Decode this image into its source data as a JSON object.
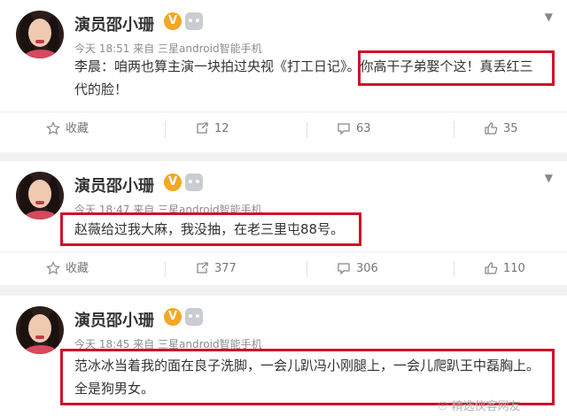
{
  "posts": [
    {
      "username": "演员邵小珊",
      "vip_badge": "V",
      "meta": "今天 18:51 来自 三星android智能手机",
      "text_line1": "李晨：咱两也算主演一块拍过央视《打工日记》。你高干子弟娶个这！真丢红三",
      "text_line2": "代的脸！",
      "actions": {
        "favorite": "收藏",
        "repost": "12",
        "comment": "63",
        "like": "35"
      }
    },
    {
      "username": "演员邵小珊",
      "vip_badge": "V",
      "meta": "今天 18:47 来自 三星android智能手机",
      "text_line1": "赵薇给过我大麻，我没抽，在老三里屯88号。",
      "actions": {
        "favorite": "收藏",
        "repost": "377",
        "comment": "306",
        "like": "110"
      }
    },
    {
      "username": "演员邵小珊",
      "vip_badge": "V",
      "meta": "今天 18:45 来自 三星android智能手机",
      "text_line1": "范冰冰当着我的面在良子洗脚，一会儿趴冯小刚腿上，一会儿爬趴王中磊胸上。",
      "text_line2": "全是狗男女。"
    }
  ],
  "watermark": "精选侠客网友",
  "colors": {
    "highlight_border": "#d0102a",
    "vip_badge": "#f5a623",
    "text": "#333333",
    "meta": "#8c8c8c"
  },
  "icons": [
    "star-icon",
    "repost-icon",
    "comment-icon",
    "thumbs-up-icon",
    "chevron-down-icon",
    "robot-icon"
  ]
}
